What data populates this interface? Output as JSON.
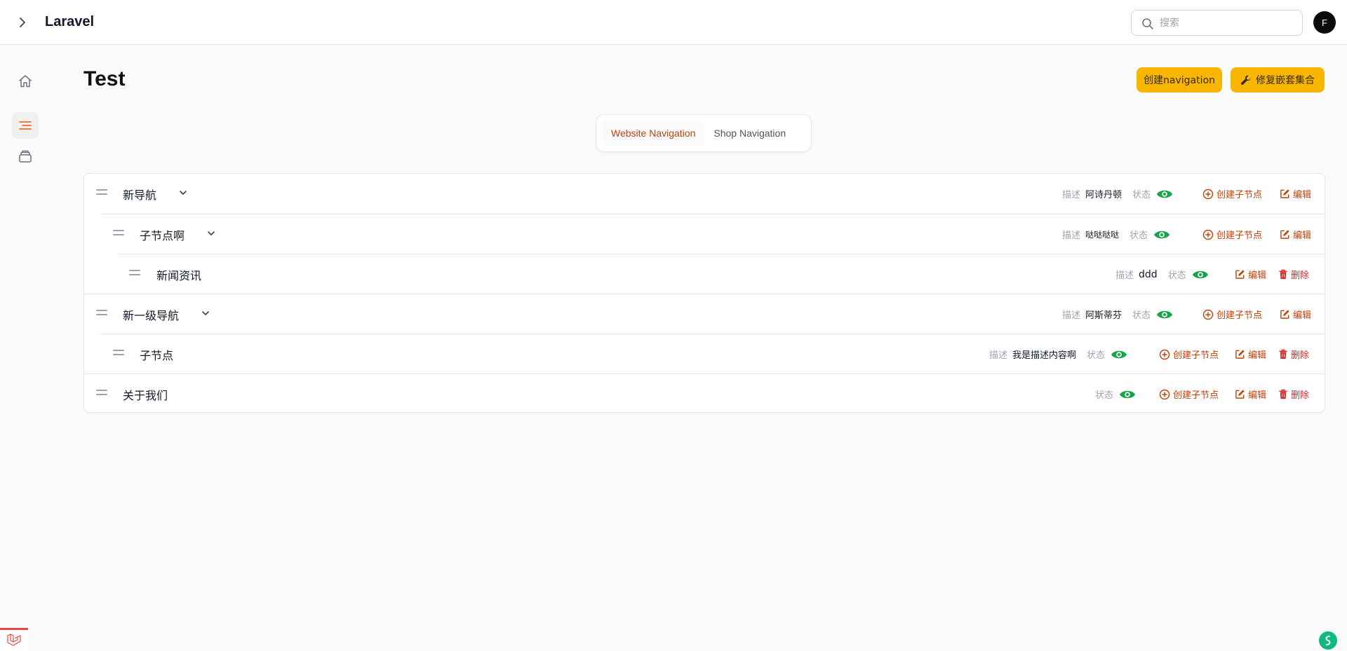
{
  "app": {
    "brand": "Laravel",
    "user_initial": "F"
  },
  "search": {
    "placeholder": "搜索",
    "value": ""
  },
  "page": {
    "title": "Test"
  },
  "header_buttons": {
    "create": "创建navigation",
    "fix": "修复嵌套集合"
  },
  "tabs": [
    {
      "label": "Website Navigation",
      "active": true
    },
    {
      "label": "Shop Navigation",
      "active": false
    }
  ],
  "labels": {
    "desc": "描述",
    "status": "状态",
    "create_child": "创建子节点",
    "edit": "编辑",
    "delete": "删除"
  },
  "nodes": [
    {
      "title": "新导航",
      "level": 0,
      "description": "阿诗丹顿",
      "status": "visible",
      "has_children": true
    },
    {
      "title": "子节点啊",
      "level": 1,
      "description": "哒哒哒哒",
      "status": "visible",
      "has_children": true
    },
    {
      "title": "新闻资讯",
      "level": 2,
      "description": "ddd",
      "status": "visible",
      "has_children": false
    },
    {
      "title": "新一级导航",
      "level": 0,
      "description": "阿斯蒂芬",
      "status": "visible",
      "has_children": true
    },
    {
      "title": "子节点",
      "level": 1,
      "description": "我是描述内容啊",
      "status": "visible",
      "has_children": false
    },
    {
      "title": "关于我们",
      "level": 0,
      "description": "",
      "status": "visible",
      "has_children": false
    }
  ],
  "colors": {
    "accent": "#f8b600",
    "link": "#c2410c",
    "danger": "#dc2626",
    "status_visible": "#16a34a"
  },
  "icons": {
    "sidebar": [
      "home-icon",
      "navigation-list-icon",
      "stack-icon"
    ],
    "topbar": [
      "chevron-right-icon",
      "search-icon"
    ]
  }
}
